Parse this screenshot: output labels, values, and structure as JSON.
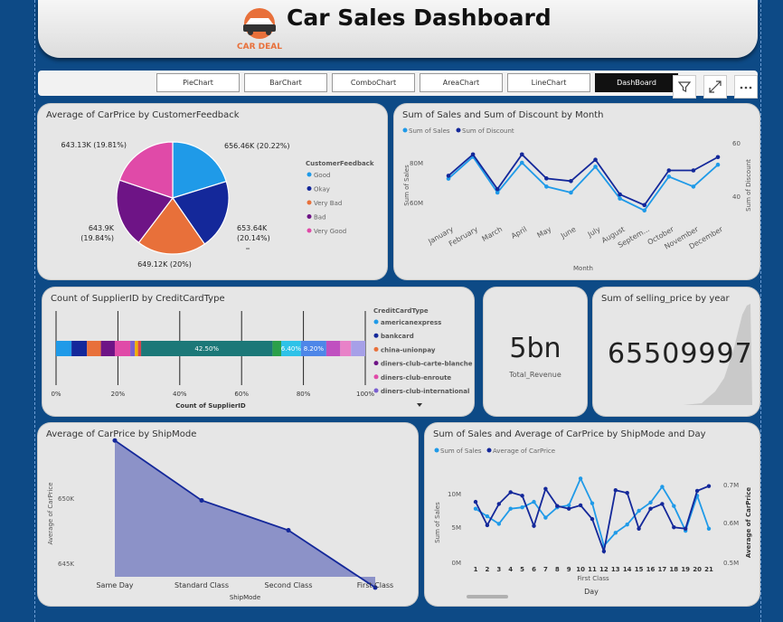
{
  "header": {
    "title": "Car Sales Dashboard",
    "logo_text": "CAR DEAL"
  },
  "nav": [
    {
      "label": "PieChart"
    },
    {
      "label": "BarChart"
    },
    {
      "label": "ComboChart"
    },
    {
      "label": "AreaChart"
    },
    {
      "label": "LineChart"
    },
    {
      "label": "DashBoard",
      "active": true
    }
  ],
  "tools": {
    "filter": "filter-icon",
    "expand": "expand-icon",
    "more": "more-icon"
  },
  "colors": {
    "bg": "#0d4a86",
    "blue": "#1f9ae8",
    "navy": "#14289a",
    "orange": "#e8703a",
    "purple": "#6e1486",
    "pink": "#e04aa8"
  },
  "pie": {
    "title": "Average of CarPrice by CustomerFeedback",
    "legend_title": "CustomerFeedback",
    "chart_data": {
      "type": "pie",
      "slices": [
        {
          "name": "Good",
          "value": 656.46,
          "label": "656.46K (20.22%)",
          "color": "#1f9ae8"
        },
        {
          "name": "Okay",
          "value": 653.64,
          "label": "653.64K",
          "label2": "(20.14%)",
          "color": "#14289a"
        },
        {
          "name": "Very Bad",
          "value": 649.12,
          "label": "649.12K (20%)",
          "color": "#e8703a"
        },
        {
          "name": "Bad",
          "value": 643.9,
          "label": "643.9K",
          "label2": "(19.84%)",
          "color": "#6e1486"
        },
        {
          "name": "Very Good",
          "value": 643.13,
          "label": "643.13K (19.81%)",
          "color": "#e04aa8"
        }
      ]
    }
  },
  "month": {
    "title": "Sum of Sales and Sum of Discount by Month",
    "legend": [
      "Sum of Sales",
      "Sum of Discount"
    ],
    "xlabel": "Month",
    "ylabel": "Sum of Sales",
    "y2label": "Sum of Discount",
    "yticks": [
      "80M",
      "60M"
    ],
    "y2ticks": [
      "60",
      "40"
    ],
    "chart_data": {
      "type": "line",
      "categories": [
        "January",
        "February",
        "March",
        "April",
        "May",
        "June",
        "July",
        "August",
        "Septem...",
        "October",
        "November",
        "December"
      ],
      "series": [
        {
          "name": "Sum of Sales",
          "values": [
            72,
            83,
            65,
            80,
            68,
            65,
            78,
            62,
            56,
            73,
            68,
            79
          ]
        },
        {
          "name": "Sum of Discount",
          "values": [
            48,
            56,
            43,
            56,
            47,
            46,
            54,
            41,
            37,
            50,
            50,
            55
          ]
        }
      ]
    }
  },
  "supplier": {
    "title": "Count of SupplierID by CreditCardType",
    "xlabel": "Count of SupplierID",
    "legend_title": "CreditCardType",
    "xticks": [
      "0%",
      "20%",
      "40%",
      "60%",
      "80%",
      "100%"
    ],
    "chart_data": {
      "type": "bar",
      "segments": [
        {
          "name": "americanexpress",
          "value": 5,
          "color": "#1f9ae8"
        },
        {
          "name": "bankcard",
          "value": 5,
          "color": "#14289a"
        },
        {
          "name": "china-unionpay",
          "value": 4.5,
          "color": "#e8703a"
        },
        {
          "name": "diners-club-carte-blanche",
          "value": 4.5,
          "color": "#6e1486"
        },
        {
          "name": "diners-club-enroute",
          "value": 5,
          "color": "#e04aa8"
        },
        {
          "name": "diners-club-international",
          "value": 1.5,
          "color": "#7a5fd0"
        },
        {
          "name": "",
          "value": 1,
          "color": "#f2b000"
        },
        {
          "name": "",
          "value": 1,
          "color": "#d64550"
        },
        {
          "name": "",
          "value": 42.5,
          "label": "42.50%",
          "color": "#1c7878"
        },
        {
          "name": "",
          "value": 2.8,
          "color": "#2ba04a"
        },
        {
          "name": "",
          "value": 6.4,
          "label": "6.40%",
          "color": "#2ec2e8"
        },
        {
          "name": "",
          "value": 8.2,
          "label": "8.20%",
          "color": "#4e86e8"
        },
        {
          "name": "",
          "value": 4.5,
          "color": "#c050c0"
        },
        {
          "name": "",
          "value": 3.5,
          "color": "#e882c8"
        },
        {
          "name": "",
          "value": 4.6,
          "color": "#a6a0e8"
        }
      ]
    }
  },
  "kpi": {
    "value": "5bn",
    "label": "Total_Revenue"
  },
  "yearcard": {
    "title": "Sum of selling_price by year",
    "value": "65509997"
  },
  "ship": {
    "title": "Average of CarPrice by ShipMode",
    "xlabel": "ShipMode",
    "ylabel": "Average of CarPrice",
    "yticks": [
      "650K",
      "645K"
    ],
    "chart_data": {
      "type": "area",
      "categories": [
        "Same Day",
        "Standard Class",
        "Second Class",
        "First Class"
      ],
      "values": [
        654.5,
        649.9,
        647.6,
        643.2
      ],
      "ylim": [
        641.8,
        656.5
      ]
    }
  },
  "day": {
    "title": "Sum of Sales and Average of CarPrice by ShipMode and Day",
    "legend": [
      "Sum of Sales",
      "Average of CarPrice"
    ],
    "xlabel": "Day",
    "xsub": "First Class",
    "ylabel": "Sum of Sales",
    "y2label": "Average of CarPrice",
    "yticks": [
      "10M",
      "5M",
      "0M"
    ],
    "y2ticks": [
      "0.7M",
      "0.6M",
      "0.5M"
    ],
    "chart_data": {
      "type": "line",
      "categories": [
        "1",
        "2",
        "3",
        "4",
        "5",
        "6",
        "7",
        "8",
        "9",
        "10",
        "11",
        "12",
        "13",
        "14",
        "15",
        "16",
        "17",
        "18",
        "19",
        "20",
        "21"
      ],
      "series": [
        {
          "name": "Sum of Sales",
          "values": [
            7.8,
            6.7,
            5.6,
            7.8,
            8.0,
            8.8,
            6.5,
            8.0,
            8.3,
            12.2,
            8.6,
            2.4,
            4.3,
            5.5,
            7.5,
            8.7,
            11.0,
            8.2,
            4.6,
            9.7,
            4.9
          ]
        },
        {
          "name": "Average of CarPrice",
          "values": [
            8.8,
            5.4,
            8.5,
            10.2,
            9.7,
            5.3,
            10.7,
            8.2,
            7.8,
            8.3,
            6.3,
            1.6,
            10.5,
            10.1,
            4.9,
            7.8,
            8.5,
            5.1,
            4.9,
            10.4,
            11.1
          ]
        }
      ]
    }
  }
}
